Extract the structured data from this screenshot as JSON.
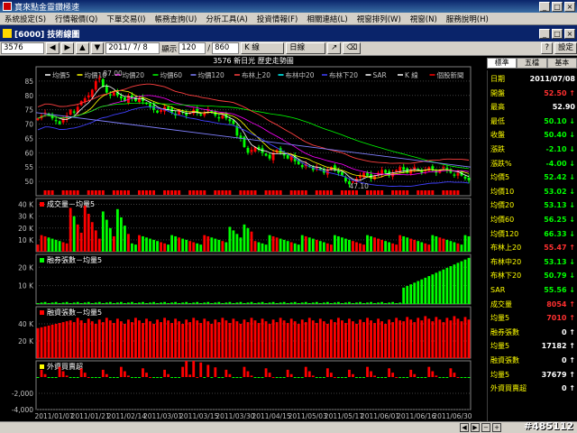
{
  "window": {
    "title": "寶來點金靈鑽極速",
    "min": "_",
    "max": "□",
    "close": "×"
  },
  "menu": [
    "系統設定(S)",
    "行情報價(Q)",
    "下單交易(I)",
    "帳務查詢(U)",
    "分析工具(A)",
    "投資情報(F)",
    "相關連結(L)",
    "視窗排列(W)",
    "視窗(N)",
    "服務說明(H)"
  ],
  "subwindow": {
    "title": "[6000] 技術線圖",
    "buttons": [
      "_",
      "□",
      "×"
    ]
  },
  "toolbar": {
    "stock_code": "3576",
    "date": "2011/ 7/ 8",
    "display_label": "顯示",
    "display_count": "120",
    "slash": "/",
    "total_count": "860",
    "kline_label": "K 線",
    "period_label": "日線",
    "draw_label": "↗",
    "erase_label": "⌫",
    "settings_label": "設定"
  },
  "right_tabs": [
    "標準",
    "五檔",
    "基本"
  ],
  "quote": [
    {
      "label": "日期",
      "value": "2011/07/08",
      "color": "#ffffff"
    },
    {
      "label": "開盤",
      "value": "52.50",
      "color": "#ff3030",
      "arrow": "↑"
    },
    {
      "label": "最高",
      "value": "52.90",
      "color": "#ffffff",
      "arrow": ""
    },
    {
      "label": "最低",
      "value": "50.10",
      "color": "#00ff00",
      "arrow": "↓"
    },
    {
      "label": "收盤",
      "value": "50.40",
      "color": "#00ff00",
      "arrow": "↓"
    },
    {
      "label": "漲跌",
      "value": "-2.10",
      "color": "#00ff00",
      "arrow": "↓"
    },
    {
      "label": "漲跌%",
      "value": "-4.00",
      "color": "#00ff00",
      "arrow": "↓"
    },
    {
      "label": "均價5",
      "value": "52.42",
      "color": "#00ff00",
      "arrow": "↓"
    },
    {
      "label": "均價10",
      "value": "53.02",
      "color": "#00ff00",
      "arrow": "↓"
    },
    {
      "label": "均價20",
      "value": "53.13",
      "color": "#00ff00",
      "arrow": "↓"
    },
    {
      "label": "均價60",
      "value": "56.25",
      "color": "#00ff00",
      "arrow": "↓"
    },
    {
      "label": "均價120",
      "value": "66.33",
      "color": "#00ff00",
      "arrow": "↓"
    },
    {
      "label": "布林上20",
      "value": "55.47",
      "color": "#ff3030",
      "arrow": "↑"
    },
    {
      "label": "布林中20",
      "value": "53.13",
      "color": "#00ff00",
      "arrow": "↓"
    },
    {
      "label": "布林下20",
      "value": "50.79",
      "color": "#00ff00",
      "arrow": "↓"
    },
    {
      "label": "SAR",
      "value": "55.56",
      "color": "#00ff00",
      "arrow": "↓"
    },
    {
      "label": "成交量",
      "value": "8054",
      "color": "#ff3030",
      "arrow": "↑"
    },
    {
      "label": "均量5",
      "value": "7010",
      "color": "#ff3030",
      "arrow": "↑"
    },
    {
      "label": "融券張數",
      "value": "0",
      "color": "#ffffff",
      "arrow": "↑"
    },
    {
      "label": "均量5",
      "value": "17182",
      "color": "#ffffff",
      "arrow": "↑"
    },
    {
      "label": "融資張數",
      "value": "0",
      "color": "#ffffff",
      "arrow": "↑"
    },
    {
      "label": "均量5",
      "value": "37679",
      "color": "#ffffff",
      "arrow": "↑"
    },
    {
      "label": "外資買賣超",
      "value": "0",
      "color": "#ffffff",
      "arrow": "↑"
    }
  ],
  "price_panel": {
    "title": "3576 新日光  歷史走勢圖",
    "legend": [
      {
        "label": "均價5",
        "color": "#ffffff"
      },
      {
        "label": "均價10",
        "color": "#ffff00"
      },
      {
        "label": "均價20",
        "color": "#ff00ff"
      },
      {
        "label": "均價60",
        "color": "#00ff00"
      },
      {
        "label": "均價120",
        "color": "#8080ff"
      },
      {
        "label": "布林上20",
        "color": "#ff4040"
      },
      {
        "label": "布林中20",
        "color": "#00ffff"
      },
      {
        "label": "布林下20",
        "color": "#4040ff"
      },
      {
        "label": "SAR",
        "color": "#ffffff"
      },
      {
        "label": "K 線",
        "color": "#ffffff"
      },
      {
        "label": "個股新聞",
        "color": "#ff0000"
      }
    ],
    "annot_high": "87.00",
    "annot_low": "47.10"
  },
  "vol_panel": {
    "title": "成交量－均量5"
  },
  "short_panel": {
    "title": "融券張數－均量5"
  },
  "margin_panel": {
    "title": "融資張數－均量5"
  },
  "foreign_panel": {
    "title": "外資買賣超"
  },
  "status": {
    "watermark": "#485112"
  },
  "colors": {
    "up": "#ff0000",
    "down": "#00ff00",
    "grid": "#404040",
    "axis": "#c0c0c0"
  },
  "chart_data": [
    {
      "type": "candlestick",
      "title": "3576 新日光  歷史走勢圖",
      "ylim": [
        45,
        90
      ],
      "yticks": [
        50,
        55,
        60,
        65,
        70,
        75,
        80,
        85
      ],
      "x": [
        "2011/01/07",
        "2011/01/21",
        "2011/02/14",
        "2011/03/01",
        "2011/03/15",
        "2011/03/30",
        "2011/04/15",
        "2011/05/03",
        "2011/05/17",
        "2011/06/01",
        "2011/06/16",
        "2011/06/30"
      ],
      "close": [
        72,
        73,
        74,
        73,
        72,
        71,
        70,
        72,
        73,
        75,
        74,
        76,
        78,
        79,
        80,
        82,
        85,
        86,
        83,
        81,
        80,
        81,
        80,
        79,
        78,
        80,
        79,
        78,
        79,
        78,
        77,
        76,
        75,
        74,
        75,
        76,
        75,
        74,
        73,
        75,
        74,
        73,
        74,
        75,
        74,
        73,
        74,
        75,
        74,
        73,
        72,
        73,
        72,
        71,
        70,
        66,
        65,
        62,
        60,
        61,
        62,
        61,
        60,
        59,
        58,
        60,
        61,
        60,
        59,
        58,
        59,
        57,
        56,
        55,
        56,
        55,
        54,
        55,
        54,
        53,
        54,
        55,
        54,
        53,
        52,
        50,
        49,
        50,
        51,
        52,
        53,
        52,
        51,
        52,
        53,
        54,
        53,
        52,
        53,
        54,
        55,
        54,
        53,
        54,
        55,
        54,
        53,
        54,
        55,
        54,
        53,
        54,
        55,
        54,
        53,
        52,
        53,
        52,
        51,
        50.4
      ]
    },
    {
      "type": "bar",
      "title": "成交量－均量5",
      "ylim": [
        0,
        45
      ],
      "yticks": [
        10,
        20,
        30,
        40
      ],
      "unit": "K"
    },
    {
      "type": "bar",
      "title": "融券張數－均量5",
      "ylim": [
        0,
        27
      ],
      "yticks": [
        10,
        20
      ],
      "unit": "K"
    },
    {
      "type": "bar",
      "title": "融資張數－均量5",
      "ylim": [
        0,
        60
      ],
      "yticks": [
        20,
        40
      ],
      "unit": "K"
    },
    {
      "type": "bar",
      "title": "外資買賣超",
      "ylim": [
        -4000,
        2000
      ],
      "yticks": [
        -2000,
        -4000
      ]
    }
  ]
}
